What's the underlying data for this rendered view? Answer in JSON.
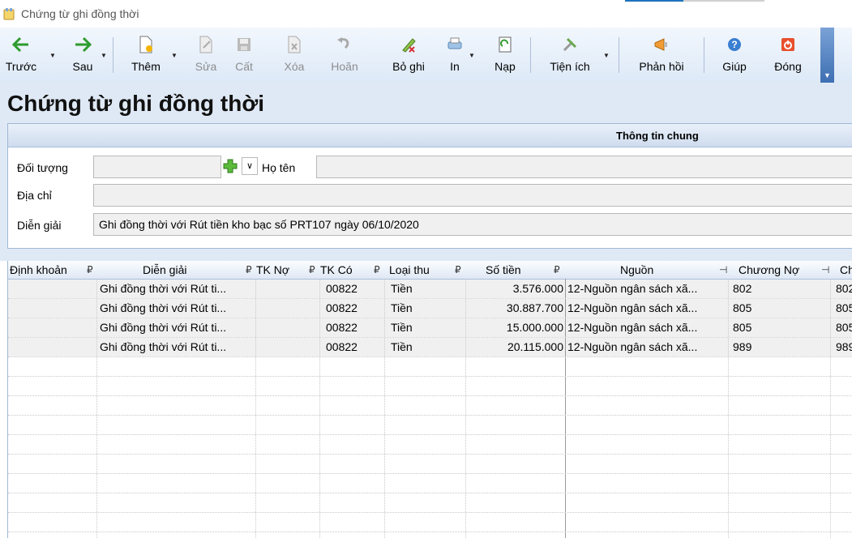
{
  "window": {
    "title": "Chứng từ ghi đồng thời"
  },
  "toolbar": {
    "prev": "Trước",
    "next": "Sau",
    "add": "Thêm",
    "edit": "Sửa",
    "save": "Cất",
    "delete": "Xóa",
    "undo": "Hoãn",
    "unpost": "Bỏ ghi",
    "print": "In",
    "load": "Nạp",
    "utilities": "Tiện ích",
    "feedback": "Phản hồi",
    "help": "Giúp",
    "close": "Đóng"
  },
  "page": {
    "title": "Chứng từ ghi đồng thời"
  },
  "general": {
    "section_title": "Thông tin chung",
    "subject_label": "Đối tượng",
    "subject_value": "",
    "name_label": "Họ tên",
    "name_value": "",
    "address_label": "Địa chỉ",
    "address_value": "",
    "description_label": "Diễn giải",
    "description_value": "Ghi đồng thời với Rút tiền kho bạc số PRT107 ngày 06/10/2020"
  },
  "grid": {
    "columns": [
      "Định khoản",
      "Diễn giải",
      "TK Nợ",
      "TK Có",
      "Loại thu",
      "Số tiền",
      "Nguồn",
      "Chương Nợ",
      "Ch"
    ],
    "rows": [
      [
        "",
        "Ghi đồng thời với Rút ti...",
        "",
        "00822",
        "Tiền",
        "3.576.000",
        "12-Nguồn ngân sách xã...",
        "802",
        "802"
      ],
      [
        "",
        "Ghi đồng thời với Rút ti...",
        "",
        "00822",
        "Tiền",
        "30.887.700",
        "12-Nguồn ngân sách xã...",
        "805",
        "805"
      ],
      [
        "",
        "Ghi đồng thời với Rút ti...",
        "",
        "00822",
        "Tiền",
        "15.000.000",
        "12-Nguồn ngân sách xã...",
        "805",
        "805"
      ],
      [
        "",
        "Ghi đồng thời với Rút ti...",
        "",
        "00822",
        "Tiền",
        "20.115.000",
        "12-Nguồn ngân sách xã...",
        "989",
        "989"
      ]
    ]
  }
}
